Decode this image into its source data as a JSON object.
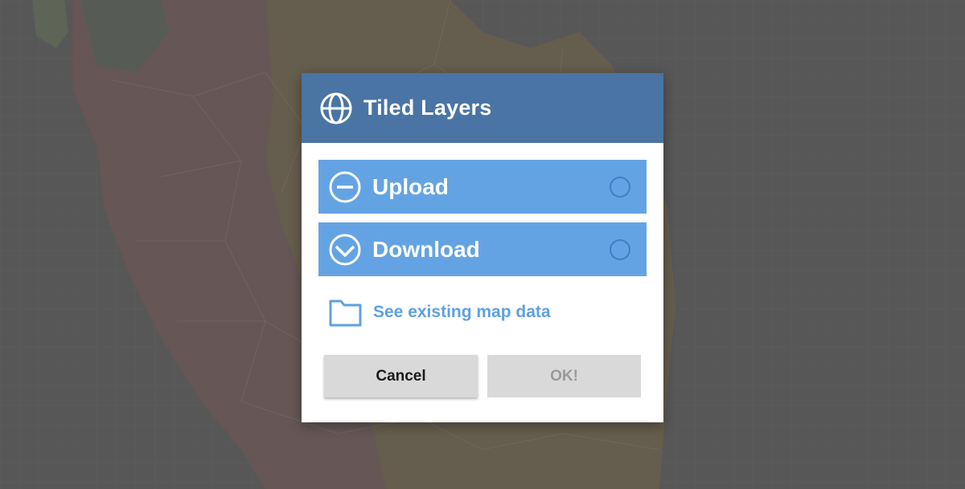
{
  "dialog": {
    "title": "Tiled Layers",
    "title_icon": "globe-icon",
    "options": [
      {
        "label": "Upload",
        "icon": "minus-circle-icon",
        "selected": false
      },
      {
        "label": "Download",
        "icon": "chevron-down-circle-icon",
        "selected": false
      }
    ],
    "existing_link": {
      "label": "See existing map data",
      "icon": "folder-icon"
    },
    "buttons": {
      "cancel": "Cancel",
      "ok": "OK!"
    }
  },
  "colors": {
    "header": "#4a74a3",
    "option": "#64a3e3",
    "link": "#5fa0e2",
    "button": "#d9d9d9",
    "ok_text_disabled": "#9a9a9a"
  }
}
